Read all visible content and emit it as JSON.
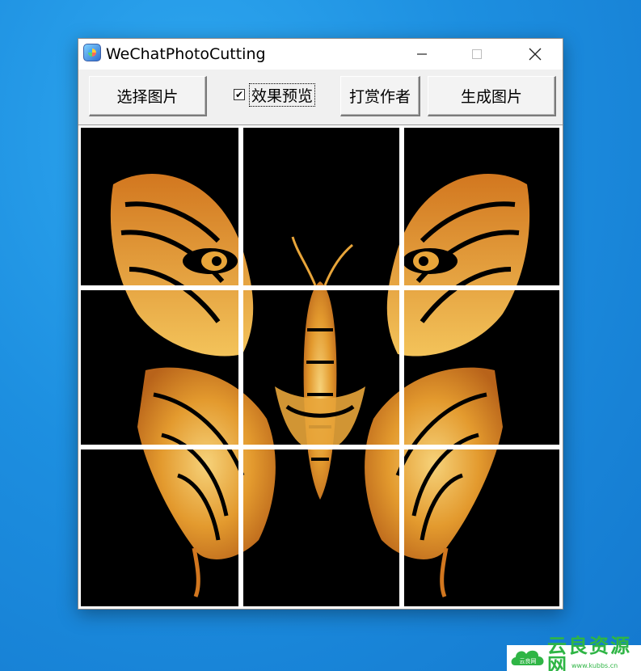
{
  "window": {
    "title": "WeChatPhotoCutting",
    "controls": {
      "minimize_icon": "minimize-icon",
      "maximize_icon": "maximize-icon",
      "close_icon": "close-icon"
    }
  },
  "toolbar": {
    "select_image_label": "选择图片",
    "preview_effect_label": "效果预览",
    "preview_effect_checked": true,
    "donate_label": "打赏作者",
    "generate_label": "生成图片"
  },
  "preview": {
    "grid": "3x3",
    "image_description_icon": "butterfly-tiger-image"
  },
  "watermark": {
    "brand": "云良资源网",
    "logo_text": "云良网",
    "url": "www.kubbs.cn"
  },
  "colors": {
    "desktop": "#1d8fe0",
    "window_bg": "#f0f0f0",
    "accent_green": "#2fb545",
    "image_gold": "#e8a53a"
  }
}
